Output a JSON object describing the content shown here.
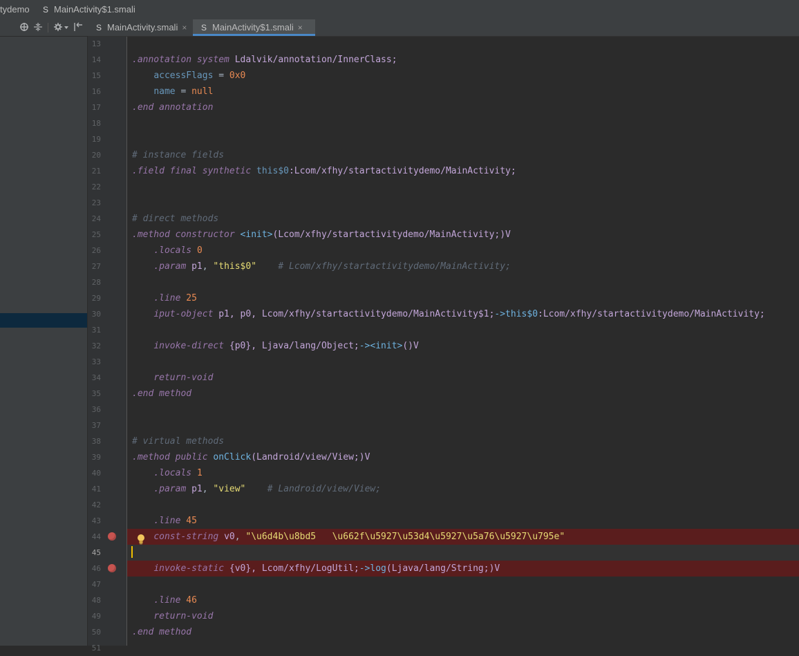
{
  "breadcrumb": {
    "project": "tydemo",
    "file_badge": "S",
    "file": "MainActivity$1.smali"
  },
  "toolbar_icons": [
    "target-icon",
    "collapse-icon",
    "gear-icon",
    "hide-icon"
  ],
  "tabs": [
    {
      "badge": "S",
      "label": "MainActivity.smali",
      "close": "×",
      "active": false
    },
    {
      "badge": "S",
      "label": "MainActivity$1.smali",
      "close": "×",
      "active": true
    }
  ],
  "colors": {
    "breakpoint": "#c75450",
    "breakpoint_line": "#5a1d1d",
    "selection": "#0d293e",
    "tab_underline": "#4a88c7"
  },
  "lines": [
    {
      "n": "13",
      "segs": []
    },
    {
      "n": "14",
      "segs": [
        [
          "tk-pur",
          ".annotation system "
        ],
        [
          "tk-typ",
          "Ldalvik/annotation/InnerClass;"
        ]
      ]
    },
    {
      "n": "15",
      "segs": [
        [
          "tk-pl",
          "    "
        ],
        [
          "tk-blu",
          "accessFlags"
        ],
        [
          "tk-pl",
          " = "
        ],
        [
          "tk-num",
          "0x0"
        ]
      ]
    },
    {
      "n": "16",
      "segs": [
        [
          "tk-pl",
          "    "
        ],
        [
          "tk-blu",
          "name"
        ],
        [
          "tk-pl",
          " = "
        ],
        [
          "tk-num",
          "null"
        ]
      ]
    },
    {
      "n": "17",
      "segs": [
        [
          "tk-pur",
          ".end annotation"
        ]
      ]
    },
    {
      "n": "18",
      "segs": []
    },
    {
      "n": "19",
      "segs": []
    },
    {
      "n": "20",
      "segs": [
        [
          "tk-cmt",
          "# instance fields"
        ]
      ]
    },
    {
      "n": "21",
      "segs": [
        [
          "tk-pur",
          ".field final synthetic "
        ],
        [
          "tk-blu",
          "this$0"
        ],
        [
          "tk-typ",
          ":Lcom/xfhy/startactivitydemo/MainActivity;"
        ]
      ]
    },
    {
      "n": "22",
      "segs": []
    },
    {
      "n": "23",
      "segs": []
    },
    {
      "n": "24",
      "segs": [
        [
          "tk-cmt",
          "# direct methods"
        ]
      ]
    },
    {
      "n": "25",
      "segs": [
        [
          "tk-pur",
          ".method constructor "
        ],
        [
          "tk-ref",
          "<init>"
        ],
        [
          "tk-typ",
          "(Lcom/xfhy/startactivitydemo/MainActivity;)V"
        ]
      ]
    },
    {
      "n": "26",
      "segs": [
        [
          "tk-pl",
          "    "
        ],
        [
          "tk-pur",
          ".locals "
        ],
        [
          "tk-num",
          "0"
        ]
      ]
    },
    {
      "n": "27",
      "segs": [
        [
          "tk-pl",
          "    "
        ],
        [
          "tk-pur",
          ".param "
        ],
        [
          "tk-typ",
          "p1"
        ],
        [
          "tk-pl",
          ", "
        ],
        [
          "tk-str",
          "\"this$0\""
        ],
        [
          "tk-pl",
          "    "
        ],
        [
          "tk-cmt",
          "# Lcom/xfhy/startactivitydemo/MainActivity;"
        ]
      ]
    },
    {
      "n": "28",
      "segs": []
    },
    {
      "n": "29",
      "segs": [
        [
          "tk-pl",
          "    "
        ],
        [
          "tk-pur",
          ".line "
        ],
        [
          "tk-num",
          "25"
        ]
      ]
    },
    {
      "n": "30",
      "segs": [
        [
          "tk-pl",
          "    "
        ],
        [
          "tk-pur",
          "iput-object "
        ],
        [
          "tk-typ",
          "p1, p0, Lcom/xfhy/startactivitydemo/MainActivity$1;"
        ],
        [
          "tk-ref",
          "->this$0"
        ],
        [
          "tk-typ",
          ":Lcom/xfhy/startactivitydemo/MainActivity;"
        ]
      ]
    },
    {
      "n": "31",
      "segs": []
    },
    {
      "n": "32",
      "segs": [
        [
          "tk-pl",
          "    "
        ],
        [
          "tk-pur",
          "invoke-direct "
        ],
        [
          "tk-typ",
          "{p0}, Ljava/lang/Object;"
        ],
        [
          "tk-ref",
          "-><init>"
        ],
        [
          "tk-typ",
          "()V"
        ]
      ]
    },
    {
      "n": "33",
      "segs": []
    },
    {
      "n": "34",
      "segs": [
        [
          "tk-pl",
          "    "
        ],
        [
          "tk-pur",
          "return-void"
        ]
      ]
    },
    {
      "n": "35",
      "segs": [
        [
          "tk-pur",
          ".end method"
        ]
      ]
    },
    {
      "n": "36",
      "segs": []
    },
    {
      "n": "37",
      "segs": []
    },
    {
      "n": "38",
      "segs": [
        [
          "tk-cmt",
          "# virtual methods"
        ]
      ]
    },
    {
      "n": "39",
      "segs": [
        [
          "tk-pur",
          ".method public "
        ],
        [
          "tk-ref",
          "onClick"
        ],
        [
          "tk-typ",
          "(Landroid/view/View;)V"
        ]
      ]
    },
    {
      "n": "40",
      "segs": [
        [
          "tk-pl",
          "    "
        ],
        [
          "tk-pur",
          ".locals "
        ],
        [
          "tk-num",
          "1"
        ]
      ]
    },
    {
      "n": "41",
      "segs": [
        [
          "tk-pl",
          "    "
        ],
        [
          "tk-pur",
          ".param "
        ],
        [
          "tk-typ",
          "p1"
        ],
        [
          "tk-pl",
          ", "
        ],
        [
          "tk-str",
          "\"view\""
        ],
        [
          "tk-pl",
          "    "
        ],
        [
          "tk-cmt",
          "# Landroid/view/View;"
        ]
      ]
    },
    {
      "n": "42",
      "segs": []
    },
    {
      "n": "43",
      "segs": [
        [
          "tk-pl",
          "    "
        ],
        [
          "tk-pur",
          ".line "
        ],
        [
          "tk-num",
          "45"
        ]
      ]
    },
    {
      "n": "44",
      "bp": true,
      "segs": [
        [
          "tk-pl",
          "    "
        ],
        [
          "tk-pur",
          "const-string "
        ],
        [
          "tk-typ",
          "v0"
        ],
        [
          "tk-pl",
          ", "
        ],
        [
          "tk-str",
          "\"\\u6d4b\\u8bd5   \\u662f\\u5927\\u53d4\\u5927\\u5a76\\u5927\\u795e\""
        ]
      ]
    },
    {
      "n": "45",
      "caret": true,
      "segs": []
    },
    {
      "n": "46",
      "bp": true,
      "segs": [
        [
          "tk-pl",
          "    "
        ],
        [
          "tk-pur",
          "invoke-static "
        ],
        [
          "tk-typ",
          "{v0}, Lcom/xfhy/LogUtil;"
        ],
        [
          "tk-ref",
          "->log"
        ],
        [
          "tk-typ",
          "(Ljava/lang/String;)V"
        ]
      ]
    },
    {
      "n": "47",
      "segs": []
    },
    {
      "n": "48",
      "segs": [
        [
          "tk-pl",
          "    "
        ],
        [
          "tk-pur",
          ".line "
        ],
        [
          "tk-num",
          "46"
        ]
      ]
    },
    {
      "n": "49",
      "segs": [
        [
          "tk-pl",
          "    "
        ],
        [
          "tk-pur",
          "return-void"
        ]
      ]
    },
    {
      "n": "50",
      "segs": [
        [
          "tk-pur",
          ".end method"
        ]
      ]
    },
    {
      "n": "51",
      "segs": []
    }
  ]
}
